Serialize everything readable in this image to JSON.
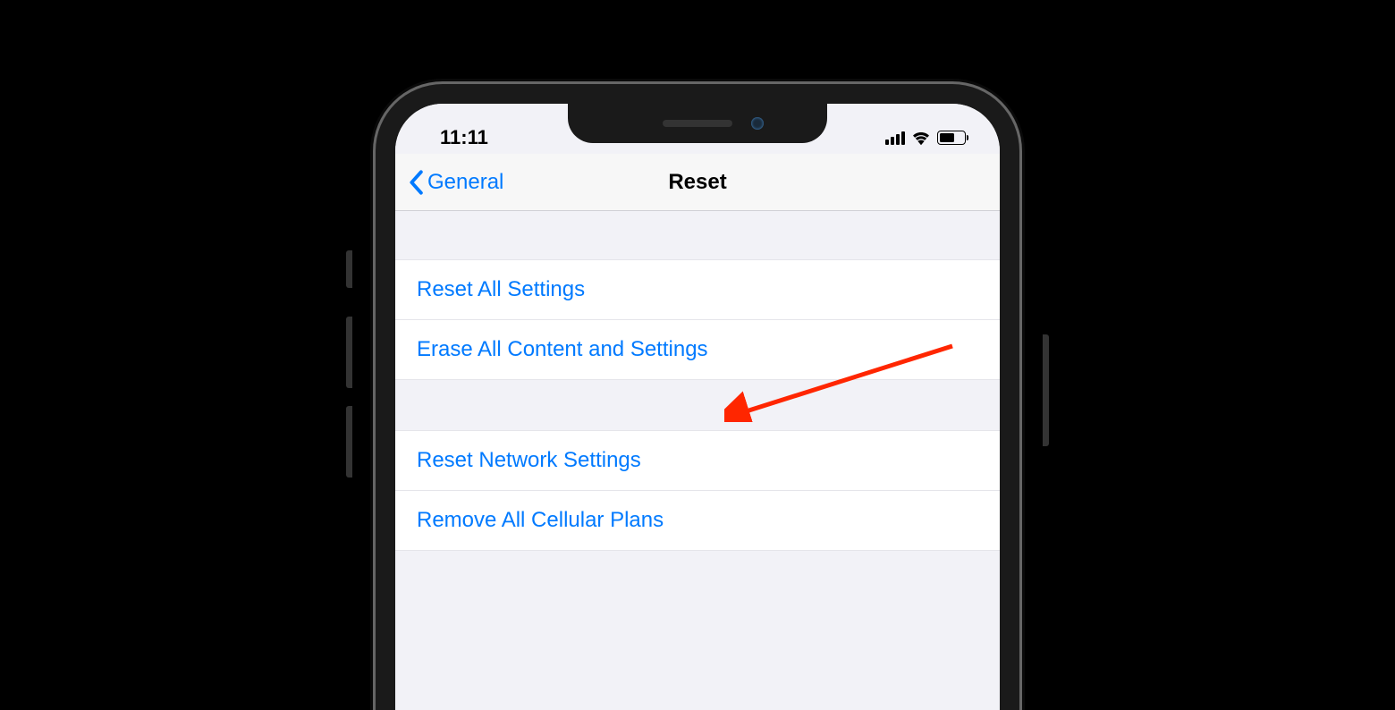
{
  "status_bar": {
    "time": "11:11"
  },
  "nav": {
    "back_label": "General",
    "title": "Reset"
  },
  "groups": [
    {
      "items": [
        {
          "label": "Reset All Settings"
        },
        {
          "label": "Erase All Content and Settings"
        }
      ]
    },
    {
      "items": [
        {
          "label": "Reset Network Settings"
        },
        {
          "label": "Remove All Cellular Plans"
        }
      ]
    }
  ],
  "colors": {
    "ios_blue": "#007AFF",
    "annotation_red": "#FF2600"
  }
}
